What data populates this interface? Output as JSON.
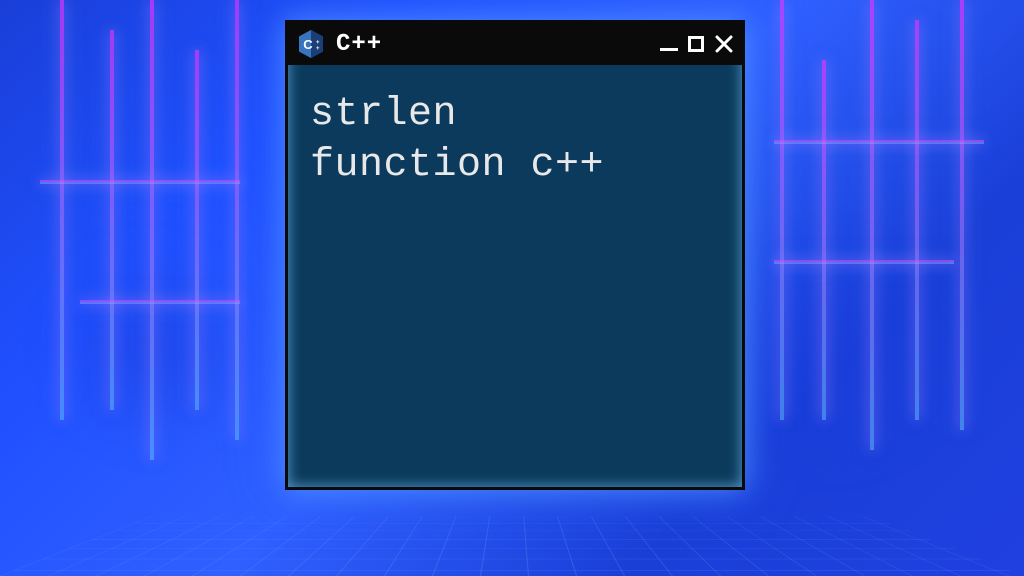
{
  "window": {
    "title": "C++",
    "icon_name": "cpp-logo-icon",
    "body_text": "strlen\nfunction c++"
  },
  "colors": {
    "window_bg": "#0b3a5c",
    "titlebar_bg": "#0a0a0a",
    "title_fg": "#ffffff",
    "code_fg": "#e8e8e8",
    "glow": "#4fa3ff"
  }
}
